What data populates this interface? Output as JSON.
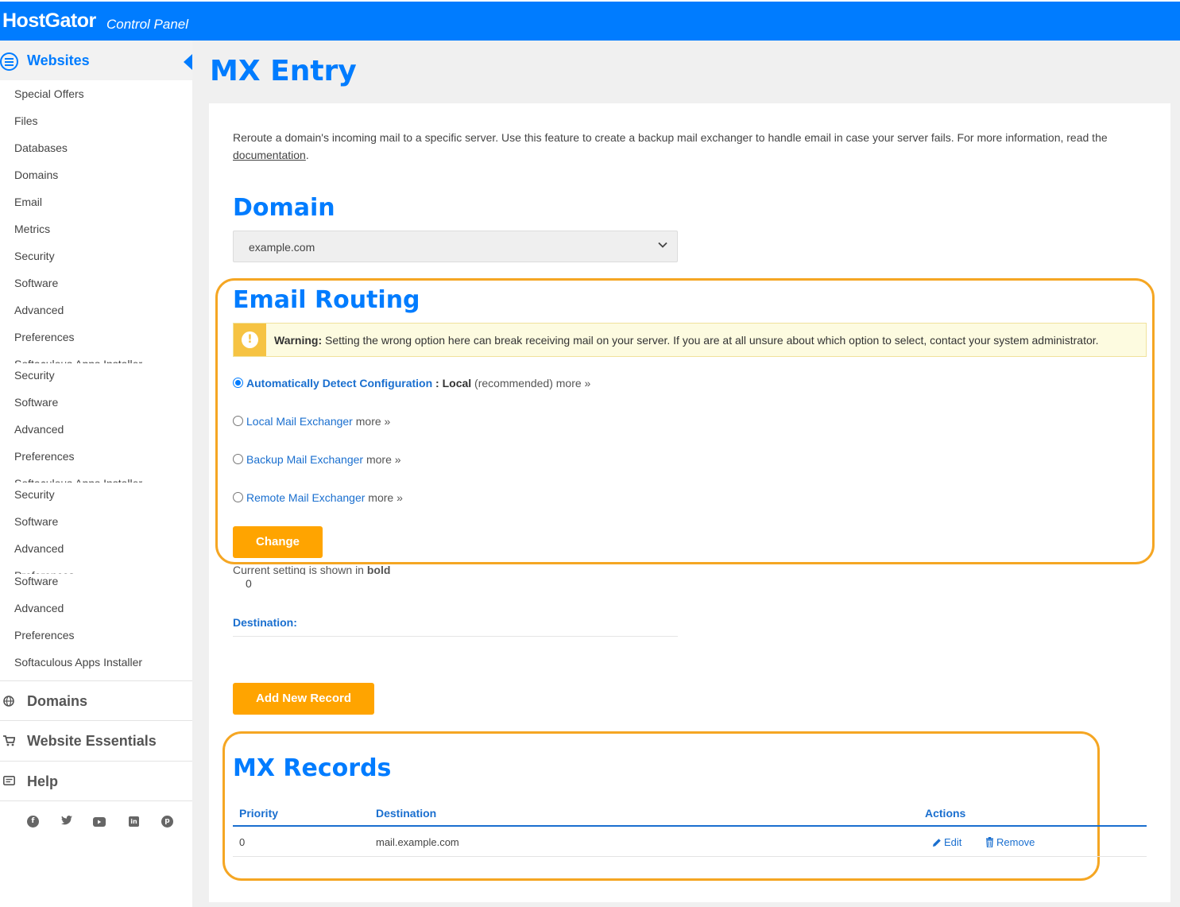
{
  "header": {
    "brand": "HostGator",
    "subtitle": "Control Panel"
  },
  "sidebar": {
    "section_title": "Websites",
    "items": [
      "Special Offers",
      "Files",
      "Databases",
      "Domains",
      "Email",
      "Metrics",
      "Security",
      "Software",
      "Advanced",
      "Preferences",
      "Softaculous Apps Installer",
      "Security",
      "Software",
      "Advanced",
      "Preferences",
      "Softaculous Apps Installer",
      "Security",
      "Software",
      "Advanced",
      "Preferences",
      "Software",
      "Advanced",
      "Preferences",
      "Softaculous Apps Installer"
    ],
    "sections": [
      "Domains",
      "Website Essentials",
      "Help"
    ],
    "social_icons": [
      "facebook-icon",
      "twitter-icon",
      "youtube-icon",
      "linkedin-icon",
      "pinterest-icon"
    ]
  },
  "page": {
    "title": "MX Entry",
    "intro": "Reroute a domain's incoming mail to a specific server. Use this feature to create a backup mail exchanger to handle email in case your server fails. For more information, read the",
    "intro_link": "documentation",
    "intro_end": "."
  },
  "domain": {
    "heading": "Domain",
    "selected": "example.com"
  },
  "routing": {
    "heading": "Email Routing",
    "warning_label": "Warning:",
    "warning_text": "Setting the wrong option here can break receiving mail on your server. If you are at all unsure about which option to select, contact your system administrator.",
    "options": [
      {
        "label": "Automatically Detect Configuration",
        "sep": " : ",
        "current": "Local",
        "note": " (recommended) ",
        "more": "more »"
      },
      {
        "label": "Local Mail Exchanger",
        "more": " more »"
      },
      {
        "label": "Backup Mail Exchanger",
        "more": " more »"
      },
      {
        "label": "Remote Mail Exchanger",
        "more": " more »"
      }
    ],
    "change_button": "Change",
    "current_note": "Current setting is shown in ",
    "current_bold": "bold",
    "priority_value": "0",
    "destination_label": "Destination:",
    "add_button": "Add New Record"
  },
  "records": {
    "heading": "MX Records",
    "columns": [
      "Priority",
      "Destination",
      "Actions"
    ],
    "rows": [
      {
        "priority": "0",
        "destination": "mail.example.com",
        "edit": "Edit",
        "remove": "Remove"
      }
    ]
  },
  "colors": {
    "primary": "#007cff",
    "accent": "#ffa400",
    "highlight": "#f5a623",
    "link": "#1a6fcf"
  }
}
